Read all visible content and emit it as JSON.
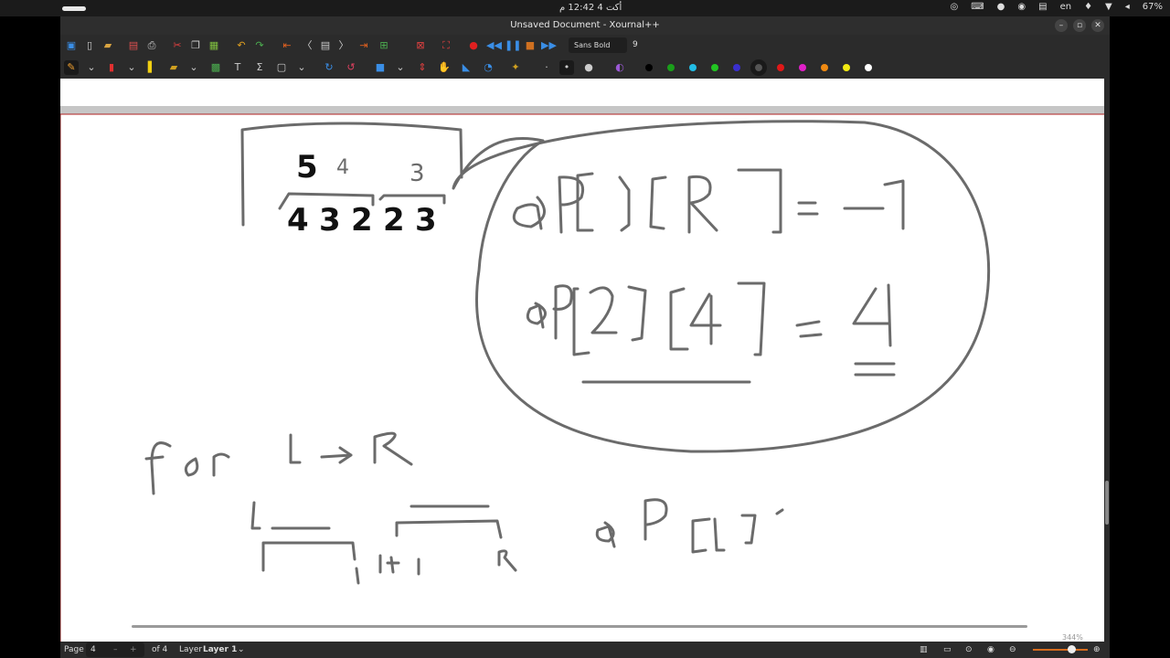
{
  "system_bar": {
    "clock": "أكت 4  12:42 م",
    "keyboard_layout": "en",
    "battery": "67%"
  },
  "window": {
    "title": "Unsaved Document - Xournal++"
  },
  "toolbar": {
    "font_name": "Sans Bold",
    "font_size": "9",
    "colors": [
      "#000000",
      "#1a9e1a",
      "#22bde6",
      "#22c422",
      "#3a2fcf",
      "#555555",
      "#e01818",
      "#e020c8",
      "#f08a12",
      "#f2ea12",
      "#ffffff"
    ]
  },
  "canvas": {
    "typed_numbers": {
      "top": [
        "5",
        "4",
        "3"
      ],
      "row": [
        "4",
        "3",
        "2",
        "2",
        "3"
      ]
    }
  },
  "status_bar": {
    "page_label": "Page",
    "page_value": "4",
    "page_of": "of 4",
    "layer_label": "Layer",
    "layer_value": "Layer 1",
    "zoom": "344%"
  }
}
